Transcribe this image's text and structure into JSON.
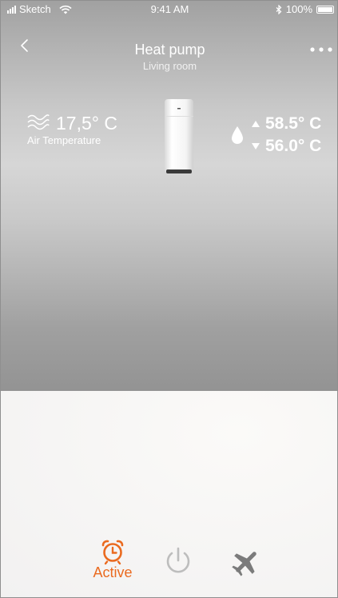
{
  "status_bar": {
    "carrier": "Sketch",
    "time": "9:41 AM",
    "battery": "100%",
    "icons": [
      "signal-icon",
      "wifi-icon",
      "bluetooth-icon",
      "battery-icon"
    ]
  },
  "nav": {
    "title": "Heat pump",
    "subtitle": "Living room",
    "back_icon": "chevron-left-icon",
    "more_icon": "more-dots-icon"
  },
  "air": {
    "value": "17,5° C",
    "label": "Air Temperature",
    "icon": "air-waves-icon"
  },
  "water": {
    "icon": "water-drop-icon",
    "upper": "58.5° C",
    "lower": "56.0° C"
  },
  "tabs": [
    {
      "label": "Active",
      "icon": "alarm-clock-icon",
      "active": true
    },
    {
      "label": "",
      "icon": "power-icon",
      "active": false
    },
    {
      "label": "",
      "icon": "airplane-icon",
      "active": false
    }
  ],
  "colors": {
    "accent": "#ea6a1f",
    "inactive": "#bdbdbd",
    "text_on_hero": "#ffffff"
  }
}
